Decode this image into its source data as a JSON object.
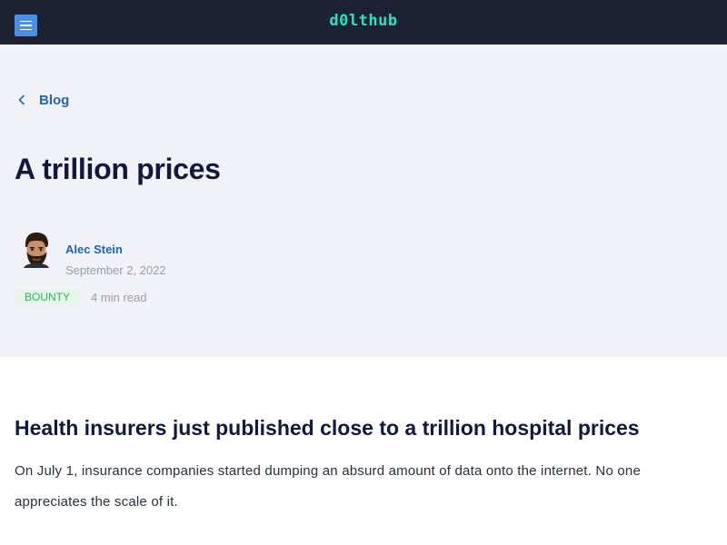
{
  "header": {
    "logo_text": "d0lthub",
    "menu_icon": "hamburger-menu-icon",
    "background_color": "#1c2234",
    "logo_color": "#29e3c1",
    "menu_button_color": "#4a8fe0"
  },
  "hero": {
    "background_color": "#f1f2f7",
    "back_link_label": "Blog",
    "back_icon": "chevron-left-icon",
    "title": "A trillion prices",
    "author_name": "Alec Stein",
    "date": "September 2, 2022",
    "tag": "BOUNTY",
    "read_time": "4 min read"
  },
  "article": {
    "heading": "Health insurers just published close to a trillion hospital prices",
    "first_paragraph": "On July 1, insurance companies started dumping an absurd amount of data onto the internet. No one appreciates the scale of it."
  }
}
